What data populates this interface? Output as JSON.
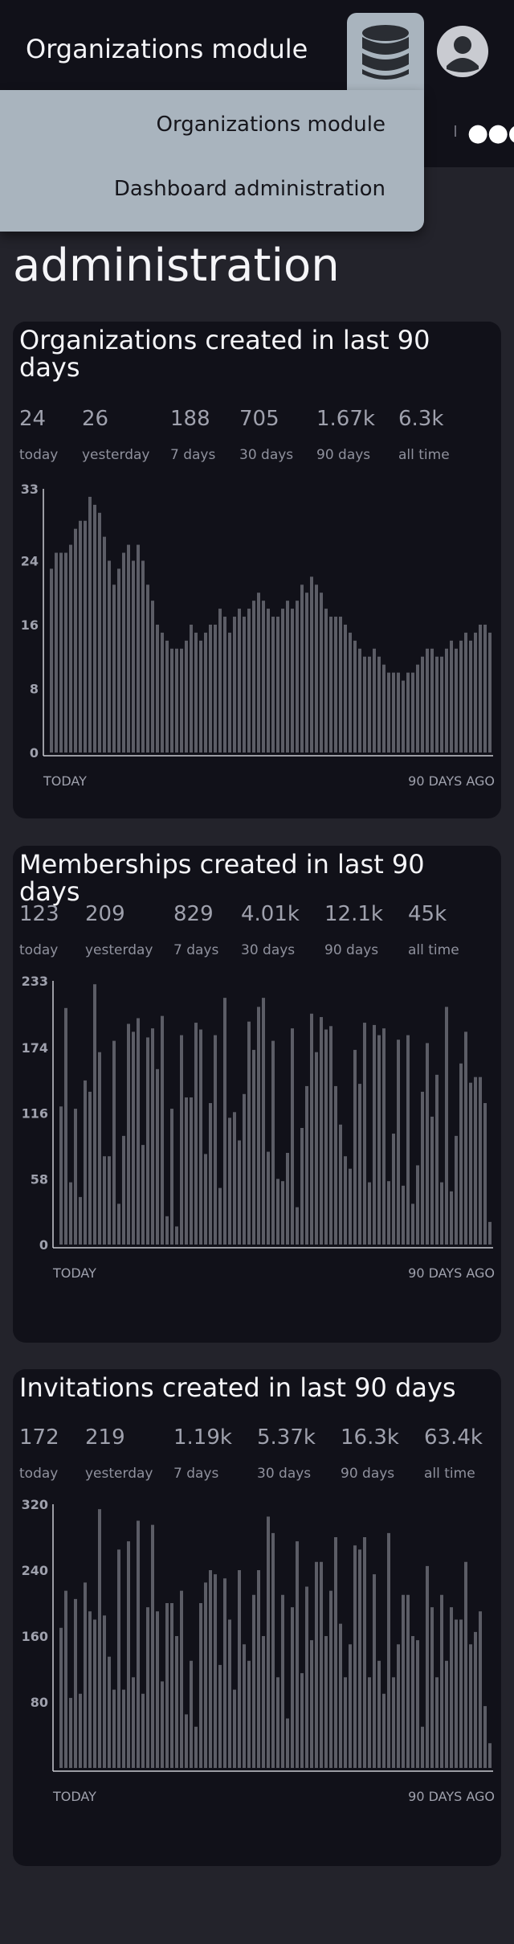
{
  "header": {
    "title": "Organizations module",
    "db_icon": "database-icon",
    "avatar_icon": "user-avatar-icon",
    "more_icon": "more-dots-icon"
  },
  "dropdown": {
    "items": [
      {
        "label": "Organizations module"
      },
      {
        "label": "Dashboard administration"
      }
    ]
  },
  "page": {
    "heading": "administration"
  },
  "colors": {
    "background": "#23232b",
    "card": "#111119",
    "bar": "#5c5d66",
    "menu": "#a9b4be",
    "muted_text": "#9fa1ad"
  },
  "cards": [
    {
      "title": "Organizations created in last 90 days",
      "stats": [
        {
          "value": "24",
          "label": "today"
        },
        {
          "value": "26",
          "label": "yesterday"
        },
        {
          "value": "188",
          "label": "7 days"
        },
        {
          "value": "705",
          "label": "30 days"
        },
        {
          "value": "1.67k",
          "label": "90 days"
        },
        {
          "value": "6.3k",
          "label": "all time"
        }
      ],
      "chart_data": {
        "type": "bar",
        "y_ticks": [
          "33",
          "24",
          "16",
          "8",
          "0"
        ],
        "ylim": [
          0,
          33
        ],
        "x_start_label": "TODAY",
        "x_end_label": "90 DAYS AGO",
        "values": [
          23,
          25,
          25,
          25,
          26,
          28,
          29,
          29,
          32,
          31,
          30,
          27,
          24,
          21,
          23,
          25,
          26,
          24,
          26,
          24,
          21,
          19,
          16,
          15,
          14,
          13,
          13,
          13,
          14,
          16,
          15,
          14,
          15,
          16,
          16,
          18,
          17,
          15,
          17,
          18,
          17,
          18,
          19,
          20,
          19,
          18,
          17,
          17,
          18,
          19,
          18,
          19,
          21,
          20,
          22,
          21,
          20,
          18,
          17,
          17,
          17,
          16,
          15,
          14,
          13,
          12,
          12,
          13,
          12,
          11,
          10,
          10,
          10,
          9,
          10,
          10,
          11,
          12,
          13,
          13,
          12,
          12,
          13,
          14,
          13,
          14,
          15,
          14,
          15,
          16,
          16,
          15
        ],
        "y_tick_values": [
          33,
          24,
          16,
          8,
          0
        ]
      }
    },
    {
      "title": "Memberships created in last 90 days",
      "stats": [
        {
          "value": "123",
          "label": "today"
        },
        {
          "value": "209",
          "label": "yesterday"
        },
        {
          "value": "829",
          "label": "7 days"
        },
        {
          "value": "4.01k",
          "label": "30 days"
        },
        {
          "value": "12.1k",
          "label": "90 days"
        },
        {
          "value": "45k",
          "label": "all time"
        }
      ],
      "chart_data": {
        "type": "bar",
        "y_ticks": [
          "233",
          "174",
          "116",
          "58",
          "0"
        ],
        "ylim": [
          0,
          233
        ],
        "x_start_label": "TODAY",
        "x_end_label": "90 DAYS AGO",
        "values": [
          122,
          209,
          55,
          120,
          42,
          145,
          135,
          230,
          170,
          78,
          78,
          180,
          36,
          96,
          195,
          188,
          200,
          88,
          183,
          191,
          155,
          202,
          25,
          120,
          16,
          185,
          130,
          130,
          196,
          190,
          80,
          125,
          185,
          50,
          218,
          112,
          117,
          92,
          133,
          197,
          172,
          210,
          218,
          82,
          180,
          58,
          56,
          81,
          191,
          33,
          103,
          140,
          204,
          170,
          201,
          190,
          193,
          140,
          106,
          78,
          67,
          172,
          142,
          196,
          55,
          194,
          185,
          191,
          56,
          98,
          181,
          52,
          185,
          36,
          70,
          135,
          178,
          113,
          150,
          55,
          210,
          47,
          96,
          160,
          188,
          143,
          148,
          148,
          125,
          20
        ],
        "y_tick_values": [
          233,
          174,
          116,
          58,
          0
        ]
      }
    },
    {
      "title": "Invitations created in last 90 days",
      "stats": [
        {
          "value": "172",
          "label": "today"
        },
        {
          "value": "219",
          "label": "yesterday"
        },
        {
          "value": "1.19k",
          "label": "7 days"
        },
        {
          "value": "5.37k",
          "label": "30 days"
        },
        {
          "value": "16.3k",
          "label": "90 days"
        },
        {
          "value": "63.4k",
          "label": "all time"
        }
      ],
      "chart_data": {
        "type": "bar",
        "y_ticks": [
          "320",
          "240",
          "160",
          "80"
        ],
        "ylim": [
          0,
          320
        ],
        "x_start_label": "TODAY",
        "x_end_label": "90 DAYS AGO",
        "values": [
          170,
          215,
          85,
          205,
          90,
          225,
          190,
          180,
          314,
          185,
          135,
          95,
          265,
          95,
          275,
          110,
          300,
          90,
          195,
          295,
          190,
          105,
          200,
          200,
          160,
          215,
          65,
          130,
          50,
          200,
          225,
          240,
          235,
          125,
          230,
          180,
          95,
          240,
          150,
          130,
          210,
          240,
          160,
          305,
          285,
          110,
          210,
          60,
          195,
          275,
          115,
          220,
          155,
          250,
          250,
          160,
          215,
          280,
          175,
          110,
          150,
          270,
          265,
          280,
          110,
          235,
          130,
          90,
          285,
          110,
          150,
          210,
          210,
          160,
          155,
          50,
          245,
          195,
          110,
          210,
          130,
          195,
          180,
          180,
          250,
          150,
          165,
          190,
          75,
          30
        ],
        "y_tick_values": [
          320,
          240,
          160,
          80
        ]
      }
    }
  ]
}
